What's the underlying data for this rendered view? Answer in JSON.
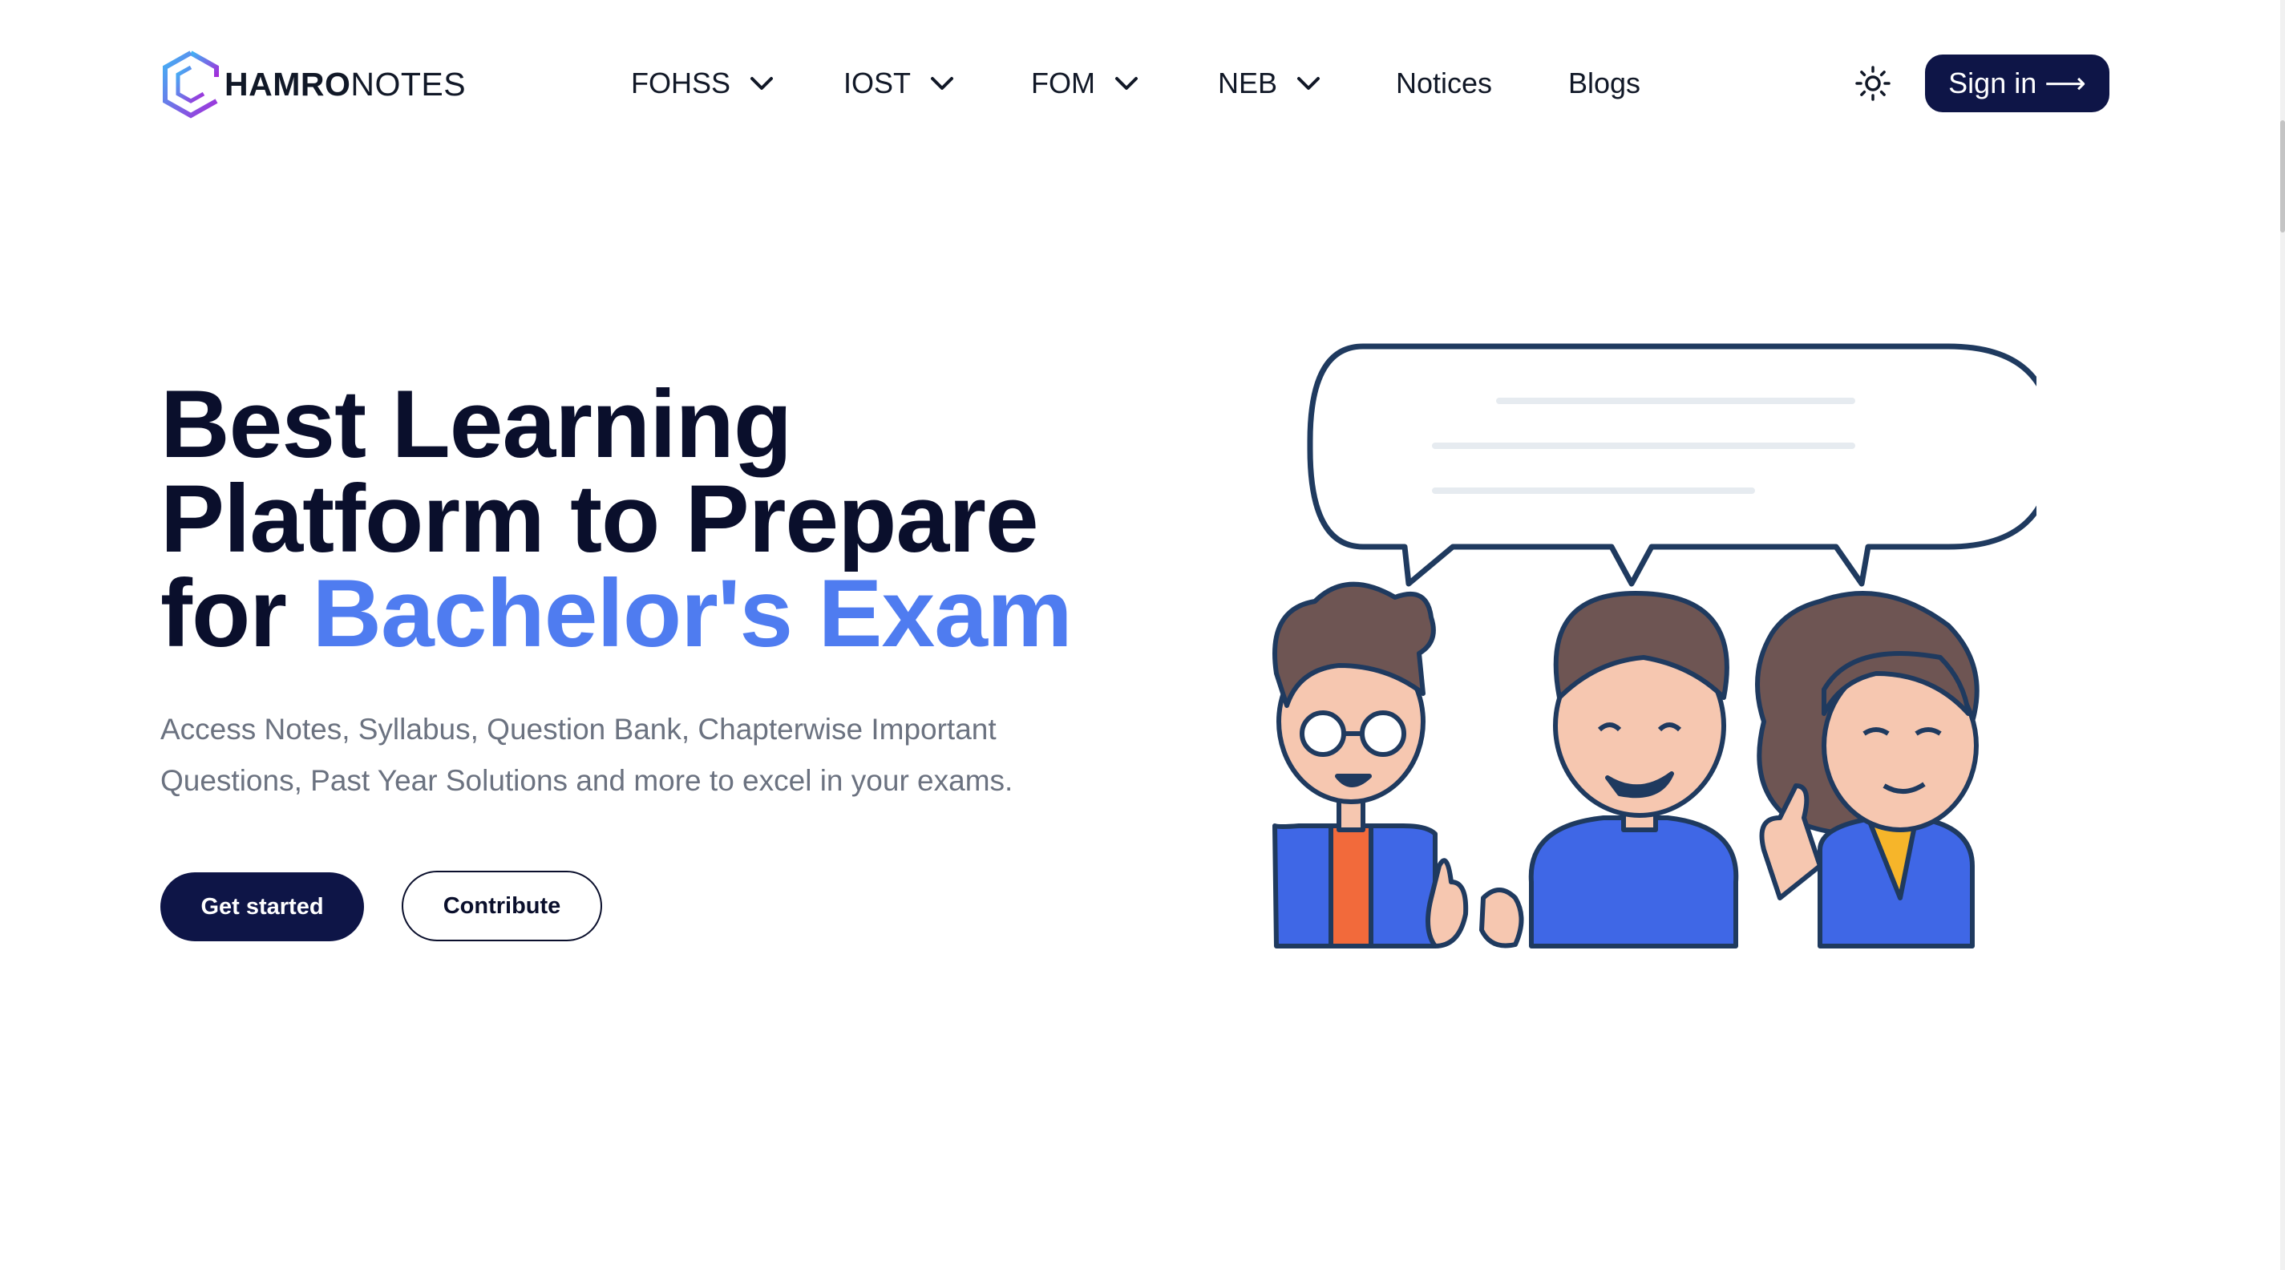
{
  "brand": {
    "bold": "HAMRO",
    "light": "NOTES"
  },
  "nav": {
    "items": [
      {
        "label": "FOHSS",
        "dropdown": true
      },
      {
        "label": "IOST",
        "dropdown": true
      },
      {
        "label": "FOM",
        "dropdown": true
      },
      {
        "label": "NEB",
        "dropdown": true
      },
      {
        "label": "Notices",
        "dropdown": false
      },
      {
        "label": "Blogs",
        "dropdown": false
      }
    ],
    "theme_icon": "sun-icon",
    "signin_label": "Sign in",
    "signin_arrow": "⟶"
  },
  "hero": {
    "title_line1": "Best Learning",
    "title_line2": "Platform to Prepare",
    "title_line3_prefix": "for",
    "title_line3_accent": "Bachelor's Exam",
    "subtitle": "Access Notes, Syllabus, Question Bank, Chapterwise Important Questions, Past Year Solutions and more to excel in your exams.",
    "primary_button": "Get started",
    "secondary_button": "Contribute"
  },
  "colors": {
    "navy": "#0e1547",
    "accent": "#4f7cf0",
    "text_muted": "#6b7280",
    "illustration_outline": "#1f3a5f",
    "shirt_blue": "#3f67e6",
    "hair_brown": "#6e5553",
    "skin": "#f6c7b0",
    "orange": "#f26a3b"
  }
}
